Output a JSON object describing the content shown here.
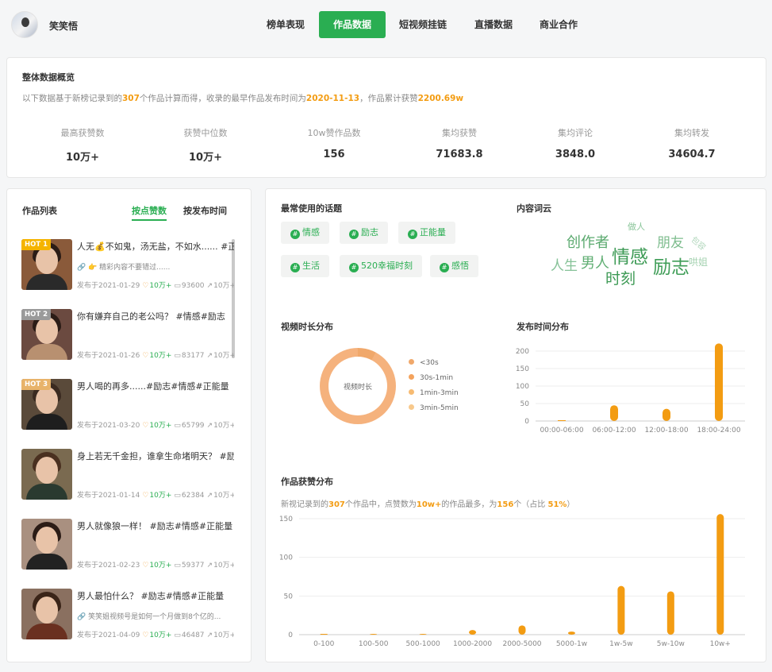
{
  "header": {
    "username": "笑笑悟",
    "tabs": [
      {
        "label": "榜单表现",
        "active": false
      },
      {
        "label": "作品数据",
        "active": true
      },
      {
        "label": "短视频挂链",
        "active": false
      },
      {
        "label": "直播数据",
        "active": false
      },
      {
        "label": "商业合作",
        "active": false
      }
    ]
  },
  "overview": {
    "title": "整体数据概览",
    "desc": {
      "p1": "以下数据基于新榜记录到的",
      "count": "307",
      "p2": "个作品计算而得，收录的最早作品发布时间为",
      "date": "2020-11-13",
      "p3": "，作品累计获赞",
      "likes": "2200.69w"
    },
    "stats": [
      {
        "label": "最高获赞数",
        "value": "10万+"
      },
      {
        "label": "获赞中位数",
        "value": "10万+"
      },
      {
        "label": "10w赞作品数",
        "value": "156"
      },
      {
        "label": "集均获赞",
        "value": "71683.8"
      },
      {
        "label": "集均评论",
        "value": "3848.0"
      },
      {
        "label": "集均转发",
        "value": "34604.7"
      }
    ]
  },
  "works": {
    "title": "作品列表",
    "sort_by_likes": "按点赞数",
    "sort_by_time": "按发布时间",
    "items": [
      {
        "badge": "HOT 1",
        "title": "人无💰不如鬼，汤无盐，不如水......  #正能量",
        "sub": "👉 精彩内容不要错过......",
        "date": "发布于2021-01-29",
        "likes": "10万+",
        "comments": "93600",
        "shares": "10万+"
      },
      {
        "badge": "HOT 2",
        "title": "你有嫌弃自己的老公吗？ #情感#励志",
        "sub": "",
        "date": "发布于2021-01-26",
        "likes": "10万+",
        "comments": "83177",
        "shares": "10万+"
      },
      {
        "badge": "HOT 3",
        "title": "男人喝的再多......#励志#情感#正能量",
        "sub": "",
        "date": "发布于2021-03-20",
        "likes": "10万+",
        "comments": "65799",
        "shares": "10万+"
      },
      {
        "badge": "",
        "title": "身上若无千金担，谁拿生命堵明天？ #励志",
        "sub": "",
        "date": "发布于2021-01-14",
        "likes": "10万+",
        "comments": "62384",
        "shares": "10万+"
      },
      {
        "badge": "",
        "title": "男人就像狼一样！ #励志#情感#正能量",
        "sub": "",
        "date": "发布于2021-02-23",
        "likes": "10万+",
        "comments": "59377",
        "shares": "10万+"
      },
      {
        "badge": "",
        "title": "男人最怕什么？ #励志#情感#正能量",
        "sub": "笑笑姐视频号是如何一个月做到8个亿的...",
        "date": "发布于2021-04-09",
        "likes": "10万+",
        "comments": "46487",
        "shares": "10万+"
      }
    ]
  },
  "topics": {
    "title": "最常使用的话题",
    "items": [
      "情感",
      "励志",
      "正能量",
      "生活",
      "520幸福时刻",
      "感悟"
    ]
  },
  "wordcloud": {
    "title": "内容词云",
    "words": [
      "做人",
      "创作者",
      "朋友",
      "包容",
      "人生",
      "男人",
      "情感",
      "励志",
      "哄姐",
      "时刻"
    ]
  },
  "duration": {
    "title": "视频时长分布",
    "center_label": "视频时长",
    "legend": [
      "<30s",
      "30s-1min",
      "1min-3min",
      "3min-5min"
    ],
    "legend_colors": [
      "#f0a86b",
      "#f4a35d",
      "#f7bb72",
      "#f8c98c"
    ]
  },
  "publish_time": {
    "title": "发布时间分布",
    "chart_data": {
      "type": "bar",
      "categories": [
        "00:00-06:00",
        "06:00-12:00",
        "12:00-18:00",
        "18:00-24:00"
      ],
      "values": [
        0,
        45,
        35,
        222
      ],
      "ylim": [
        0,
        200
      ],
      "yticks": [
        "200",
        "150",
        "100",
        "50",
        "0"
      ],
      "color": "#f39c12"
    }
  },
  "likes_dist": {
    "title": "作品获赞分布",
    "desc": {
      "p1": "新视记录到的",
      "count": "307",
      "p2": "个作品中，点赞数为",
      "range": "10w+",
      "p3": "的作品最多，为",
      "num": "156",
      "p4": "个（占比 ",
      "pct": "51%",
      "p5": "）"
    },
    "chart_data": {
      "type": "bar",
      "categories": [
        "0-100",
        "100-500",
        "500-1000",
        "1000-2000",
        "2000-5000",
        "5000-1w",
        "1w-5w",
        "5w-10w",
        "10w+"
      ],
      "values": [
        0,
        1,
        1,
        6,
        12,
        4,
        63,
        56,
        156
      ],
      "ylim": [
        0,
        150
      ],
      "yticks": [
        "150",
        "100",
        "50",
        "0"
      ],
      "color": "#f39c12"
    }
  }
}
